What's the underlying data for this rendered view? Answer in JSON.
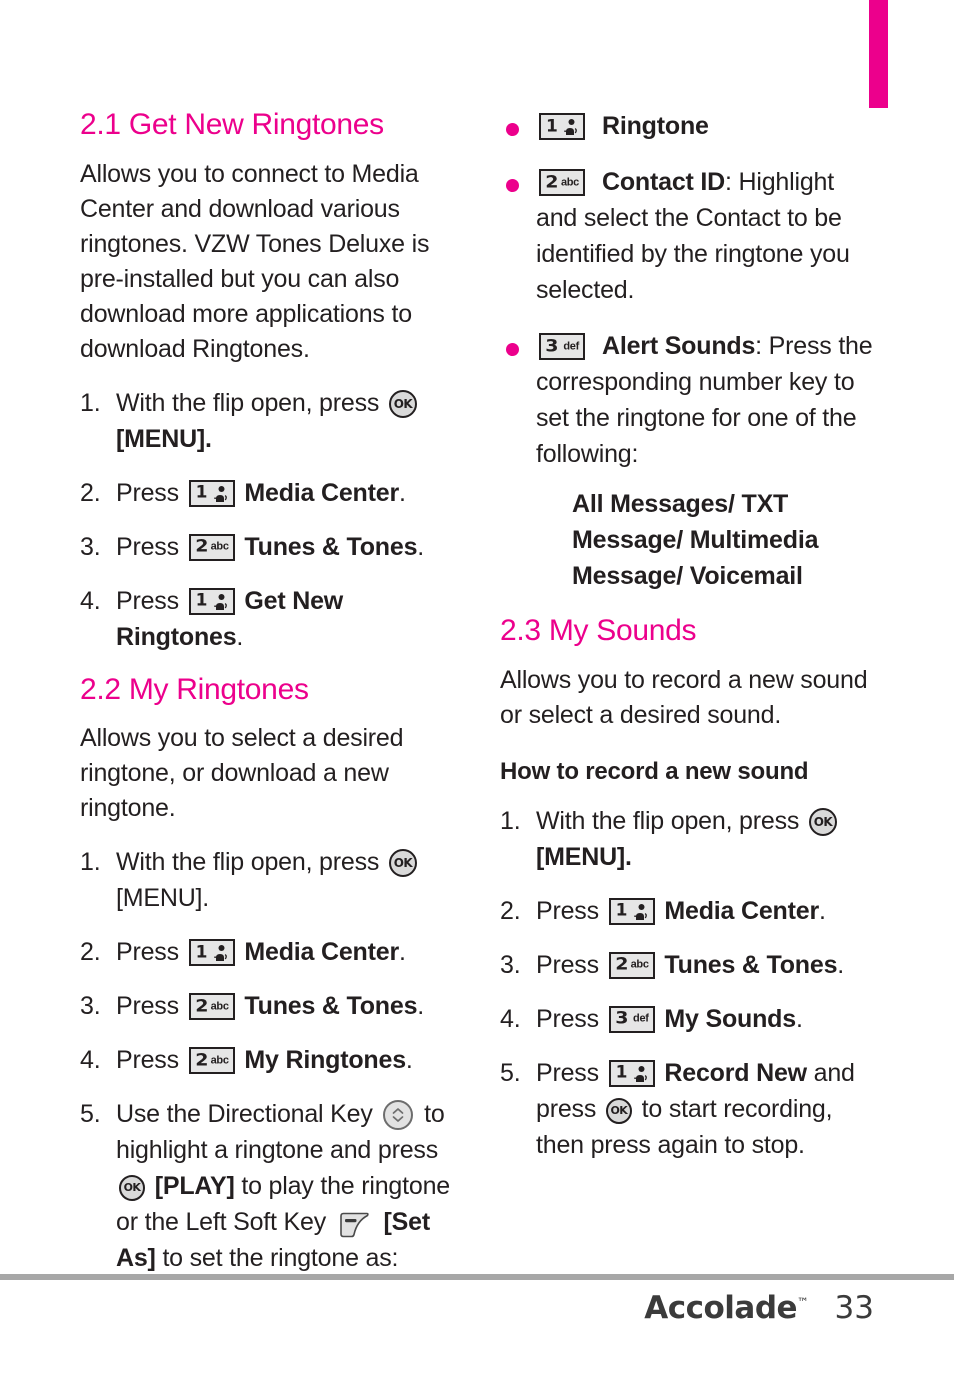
{
  "brand": {
    "accent_color": "#ec008c",
    "name": "Accolade",
    "tm": "™",
    "page_number": "33"
  },
  "keys": {
    "one": {
      "digit": "1",
      "letters": ""
    },
    "two": {
      "digit": "2",
      "letters": "abc"
    },
    "three": {
      "digit": "3",
      "letters": "def"
    },
    "ok": "OK"
  },
  "left_column": {
    "section_2_1": {
      "title": "2.1 Get New Ringtones",
      "intro": "Allows you to connect to Media Center and download various ringtones. VZW Tones Deluxe is pre-installed but you can also download more applications to download Ringtones.",
      "steps": [
        {
          "num": "1.",
          "before_key": "With the flip open, press",
          "key": "ok",
          "after_key": "",
          "second_line_bold": "[MENU]."
        },
        {
          "num": "2.",
          "before_key": "Press",
          "key": "one",
          "after_key": "",
          "bold_label": "Media Center",
          "tail": "."
        },
        {
          "num": "3.",
          "before_key": "Press",
          "key": "two",
          "after_key": "",
          "bold_label": "Tunes & Tones",
          "tail": "."
        },
        {
          "num": "4.",
          "before_key": "Press",
          "key": "one",
          "after_key": "",
          "bold_label": "Get New Ringtones",
          "tail": "."
        }
      ]
    },
    "section_2_2": {
      "title": "2.2 My Ringtones",
      "intro": "Allows you to select a desired ringtone, or download  a new ringtone.",
      "steps": [
        {
          "num": "1.",
          "before_key": "With the flip open, press",
          "key": "ok",
          "second_line": "[MENU]."
        },
        {
          "num": "2.",
          "before_key": "Press",
          "key": "one",
          "bold_label": "Media Center",
          "tail": "."
        },
        {
          "num": "3.",
          "before_key": "Press",
          "key": "two",
          "bold_label": "Tunes & Tones",
          "tail": "."
        },
        {
          "num": "4.",
          "before_key": "Press",
          "key": "two",
          "bold_label": "My Ringtones",
          "tail": "."
        }
      ],
      "step5": {
        "num": "5.",
        "part1": "Use the Directional Key",
        "part2": "to highlight a ringtone and press",
        "bold1": "[PLAY]",
        "part3": "to play the ringtone or the Left Soft Key",
        "bold2": "[Set As]",
        "part4": "to set the ringtone as:"
      }
    }
  },
  "right_column": {
    "bullets": [
      {
        "key": "one",
        "bold_label": "Ringtone",
        "rest": ""
      },
      {
        "key": "two",
        "bold_label": "Contact ID",
        "rest": ": Highlight and select the Contact to be identified by the ringtone you selected."
      },
      {
        "key": "three",
        "bold_label": "Alert Sounds",
        "rest": ": Press the corresponding number key to set the ringtone for one of the following:"
      }
    ],
    "alert_options": "All Messages/ TXT Message/ Multimedia Message/ Voicemail",
    "section_2_3": {
      "title": "2.3 My Sounds",
      "intro": "Allows you to record a new sound or select a desired sound.",
      "subhead": "How to record a new sound",
      "steps": [
        {
          "num": "1.",
          "before_key": "With the flip open, press",
          "key": "ok",
          "second_line_bold": "[MENU]."
        },
        {
          "num": "2.",
          "before_key": "Press",
          "key": "one",
          "bold_label": "Media Center",
          "tail": "."
        },
        {
          "num": "3.",
          "before_key": "Press",
          "key": "two",
          "bold_label": "Tunes & Tones",
          "tail": "."
        },
        {
          "num": "4.",
          "before_key": "Press",
          "key": "three",
          "bold_label": "My Sounds",
          "tail": "."
        }
      ],
      "step5": {
        "num": "5.",
        "before_key": "Press",
        "key": "one",
        "bold_label": "Record New",
        "after_bold": "and press",
        "tail": "to start recording, then press again to stop."
      }
    }
  }
}
